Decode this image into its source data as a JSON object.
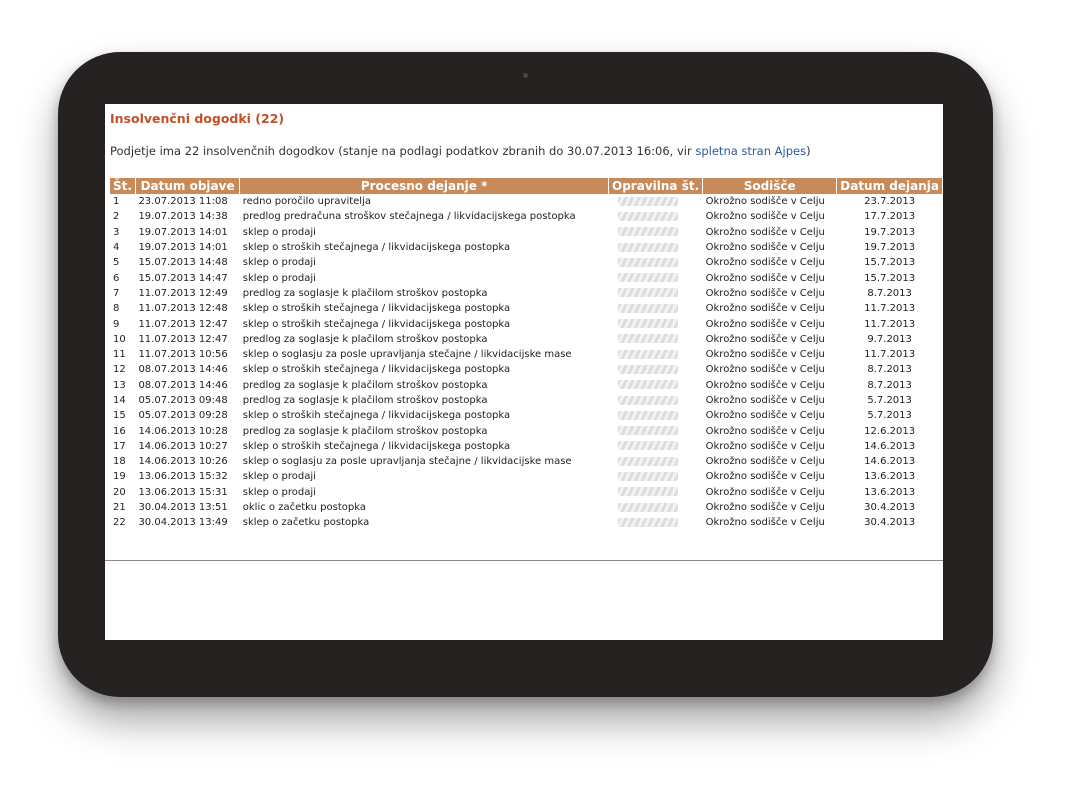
{
  "page": {
    "title": "Insolvenčni dogodki (22)",
    "intro_before": "Podjetje ima 22 insolvenčnih dogodkov (stanje na podlagi podatkov zbranih do 30.07.2013 16:06, vir ",
    "intro_link": "spletna stran Ajpes",
    "intro_after": ")"
  },
  "table": {
    "headers": {
      "num": "Št.",
      "date": "Datum objave",
      "action": "Procesno dejanje *",
      "case": "Opravilna št.",
      "court": "Sodišče",
      "action_date": "Datum dejanja"
    },
    "rows": [
      {
        "n": "1",
        "date": "23.07.2013 11:08",
        "action": "redno poročilo upravitelja",
        "court": "Okrožno sodišče v Celju",
        "action_date": "23.7.2013"
      },
      {
        "n": "2",
        "date": "19.07.2013 14:38",
        "action": "predlog predračuna stroškov stečajnega / likvidacijskega postopka",
        "court": "Okrožno sodišče v Celju",
        "action_date": "17.7.2013"
      },
      {
        "n": "3",
        "date": "19.07.2013 14:01",
        "action": "sklep o prodaji",
        "court": "Okrožno sodišče v Celju",
        "action_date": "19.7.2013"
      },
      {
        "n": "4",
        "date": "19.07.2013 14:01",
        "action": "sklep o stroških stečajnega / likvidacijskega postopka",
        "court": "Okrožno sodišče v Celju",
        "action_date": "19.7.2013"
      },
      {
        "n": "5",
        "date": "15.07.2013 14:48",
        "action": "sklep o prodaji",
        "court": "Okrožno sodišče v Celju",
        "action_date": "15.7.2013"
      },
      {
        "n": "6",
        "date": "15.07.2013 14:47",
        "action": "sklep o prodaji",
        "court": "Okrožno sodišče v Celju",
        "action_date": "15.7.2013"
      },
      {
        "n": "7",
        "date": "11.07.2013 12:49",
        "action": "predlog za soglasje k plačilom stroškov postopka",
        "court": "Okrožno sodišče v Celju",
        "action_date": "8.7.2013"
      },
      {
        "n": "8",
        "date": "11.07.2013 12:48",
        "action": "sklep o stroških stečajnega / likvidacijskega postopka",
        "court": "Okrožno sodišče v Celju",
        "action_date": "11.7.2013"
      },
      {
        "n": "9",
        "date": "11.07.2013 12:47",
        "action": "sklep o stroških stečajnega / likvidacijskega postopka",
        "court": "Okrožno sodišče v Celju",
        "action_date": "11.7.2013"
      },
      {
        "n": "10",
        "date": "11.07.2013 12:47",
        "action": "predlog za soglasje k plačilom stroškov postopka",
        "court": "Okrožno sodišče v Celju",
        "action_date": "9.7.2013"
      },
      {
        "n": "11",
        "date": "11.07.2013 10:56",
        "action": "sklep o soglasju za posle upravljanja stečajne / likvidacijske mase",
        "court": "Okrožno sodišče v Celju",
        "action_date": "11.7.2013"
      },
      {
        "n": "12",
        "date": "08.07.2013 14:46",
        "action": "sklep o stroških stečajnega / likvidacijskega postopka",
        "court": "Okrožno sodišče v Celju",
        "action_date": "8.7.2013"
      },
      {
        "n": "13",
        "date": "08.07.2013 14:46",
        "action": "predlog za soglasje k plačilom stroškov postopka",
        "court": "Okrožno sodišče v Celju",
        "action_date": "8.7.2013"
      },
      {
        "n": "14",
        "date": "05.07.2013 09:48",
        "action": "predlog za soglasje k plačilom stroškov postopka",
        "court": "Okrožno sodišče v Celju",
        "action_date": "5.7.2013"
      },
      {
        "n": "15",
        "date": "05.07.2013 09:28",
        "action": "sklep o stroških stečajnega / likvidacijskega postopka",
        "court": "Okrožno sodišče v Celju",
        "action_date": "5.7.2013"
      },
      {
        "n": "16",
        "date": "14.06.2013 10:28",
        "action": "predlog za soglasje k plačilom stroškov postopka",
        "court": "Okrožno sodišče v Celju",
        "action_date": "12.6.2013"
      },
      {
        "n": "17",
        "date": "14.06.2013 10:27",
        "action": "sklep o stroških stečajnega / likvidacijskega postopka",
        "court": "Okrožno sodišče v Celju",
        "action_date": "14.6.2013"
      },
      {
        "n": "18",
        "date": "14.06.2013 10:26",
        "action": "sklep o soglasju za posle upravljanja stečajne / likvidacijske mase",
        "court": "Okrožno sodišče v Celju",
        "action_date": "14.6.2013"
      },
      {
        "n": "19",
        "date": "13.06.2013 15:32",
        "action": "sklep o prodaji",
        "court": "Okrožno sodišče v Celju",
        "action_date": "13.6.2013"
      },
      {
        "n": "20",
        "date": "13.06.2013 15:31",
        "action": "sklep o prodaji",
        "court": "Okrožno sodišče v Celju",
        "action_date": "13.6.2013"
      },
      {
        "n": "21",
        "date": "30.04.2013 13:51",
        "action": "oklic o začetku postopka",
        "court": "Okrožno sodišče v Celju",
        "action_date": "30.4.2013"
      },
      {
        "n": "22",
        "date": "30.04.2013 13:49",
        "action": "sklep o začetku postopka",
        "court": "Okrožno sodišče v Celju",
        "action_date": "30.4.2013"
      }
    ]
  },
  "colors": {
    "header_bg": "#c98a5a",
    "title": "#c0502a",
    "link": "#2a5a9a",
    "device_frame": "#262221"
  }
}
